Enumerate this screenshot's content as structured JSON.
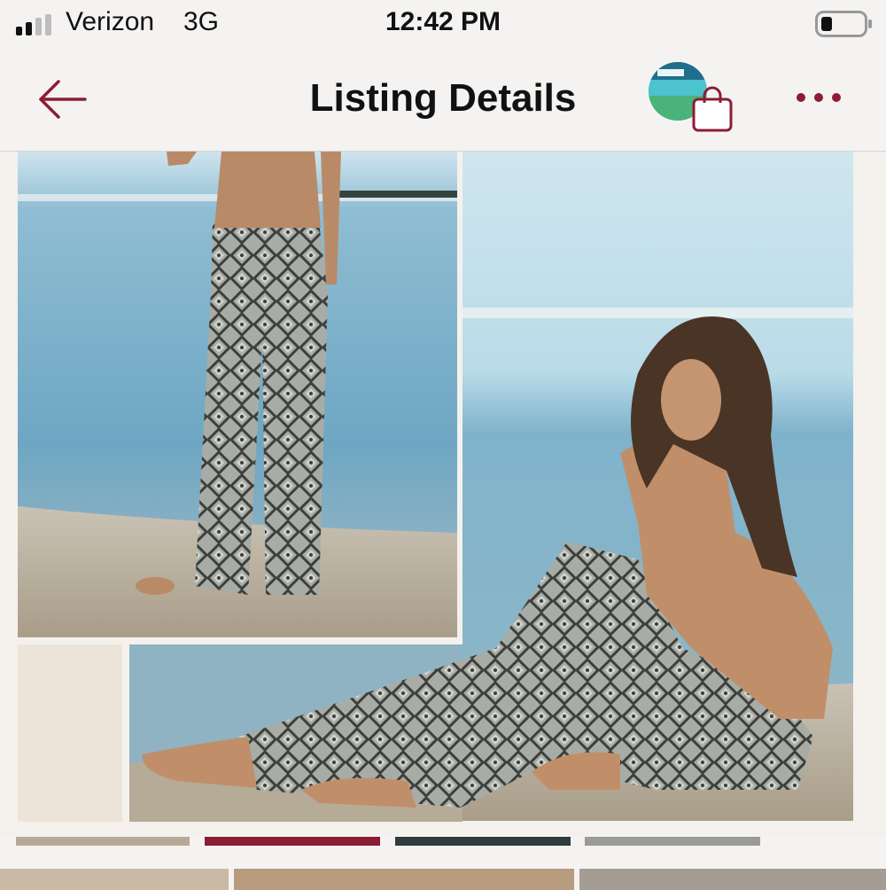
{
  "status_bar": {
    "carrier": "Verizon",
    "network": "3G",
    "time": "12:42 PM",
    "signal_bars": 4,
    "signal_bars_filled": 2
  },
  "nav": {
    "title": "Listing Details",
    "back_icon": "arrow-left-icon",
    "bag_icon": "shopping-bag-icon",
    "more_icon": "more-dots-icon",
    "accent_color": "#8c1c34"
  },
  "listing": {
    "image_description_icon": "product-photo",
    "thumbnails_count": 4,
    "selected_thumbnail": 2
  }
}
